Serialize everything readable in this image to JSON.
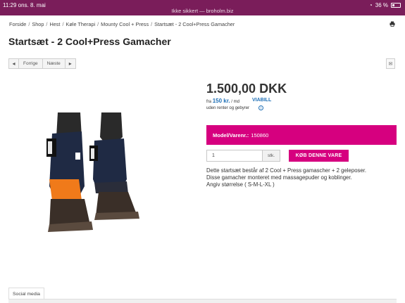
{
  "status_bar": {
    "time": "11:29",
    "date": "ons. 8. mai",
    "url_text": "Ikke sikkert — broholm.biz",
    "battery": "36 %",
    "wifi_icon": "wifi-icon",
    "battery_icon": "battery-icon"
  },
  "breadcrumb": [
    "Forside",
    "Shop",
    "Hest",
    "Køle Therapi",
    "Mounty Cool + Press",
    "Startsæt - 2 Cool+Press Gamacher"
  ],
  "product": {
    "title": "Startsæt - 2 Cool+Press Gamacher",
    "price": "1.500,00 DKK",
    "finance_prefix": "fra",
    "finance_amount": "150 kr.",
    "finance_suffix": "/ md",
    "finance_note": "uden renter og gebyrer",
    "finance_brand": "VIABILL",
    "model_label": "Model/Varenr.:",
    "model_number": "150860",
    "qty_value": "1",
    "qty_unit": "stk.",
    "buy_label": "KØB DENNE VARE",
    "description": [
      "Dette startsæt består af 2 Cool + Press gamascher + 2 geleposer.",
      "Disse gamacher monteret med massagepuder og koblinger.",
      "Angiv størrelse ( S-M-L-XL )"
    ]
  },
  "pager": {
    "prev_label": "Forrige",
    "next_label": "Næste"
  },
  "tabs": {
    "social_media": "Social media"
  },
  "colors": {
    "accent": "#d6007f",
    "status_bar": "#7a1d5a",
    "link_blue": "#1e6fb6"
  }
}
